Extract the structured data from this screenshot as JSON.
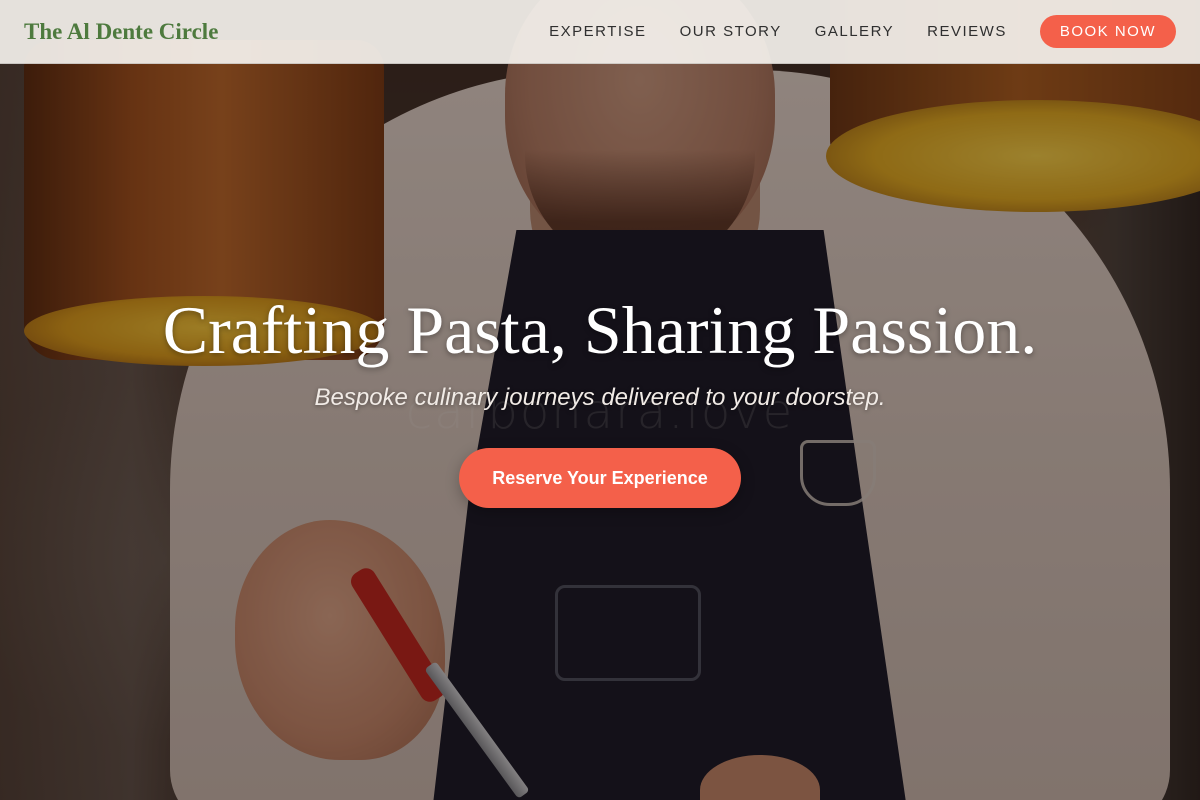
{
  "header": {
    "brand": "The Al Dente Circle",
    "nav": [
      "EXPERTISE",
      "OUR STORY",
      "GALLERY",
      "REVIEWS"
    ],
    "book_button": "BOOK NOW"
  },
  "hero": {
    "title": "Crafting Pasta, Sharing Passion.",
    "subtitle": "Bespoke culinary journeys delivered to your doorstep.",
    "cta": "Reserve Your Experience",
    "watermark": "carbonara.love"
  },
  "colors": {
    "brand_green": "#4d7a3e",
    "accent_coral": "#f4604a",
    "header_bg": "#f5f2ee"
  }
}
